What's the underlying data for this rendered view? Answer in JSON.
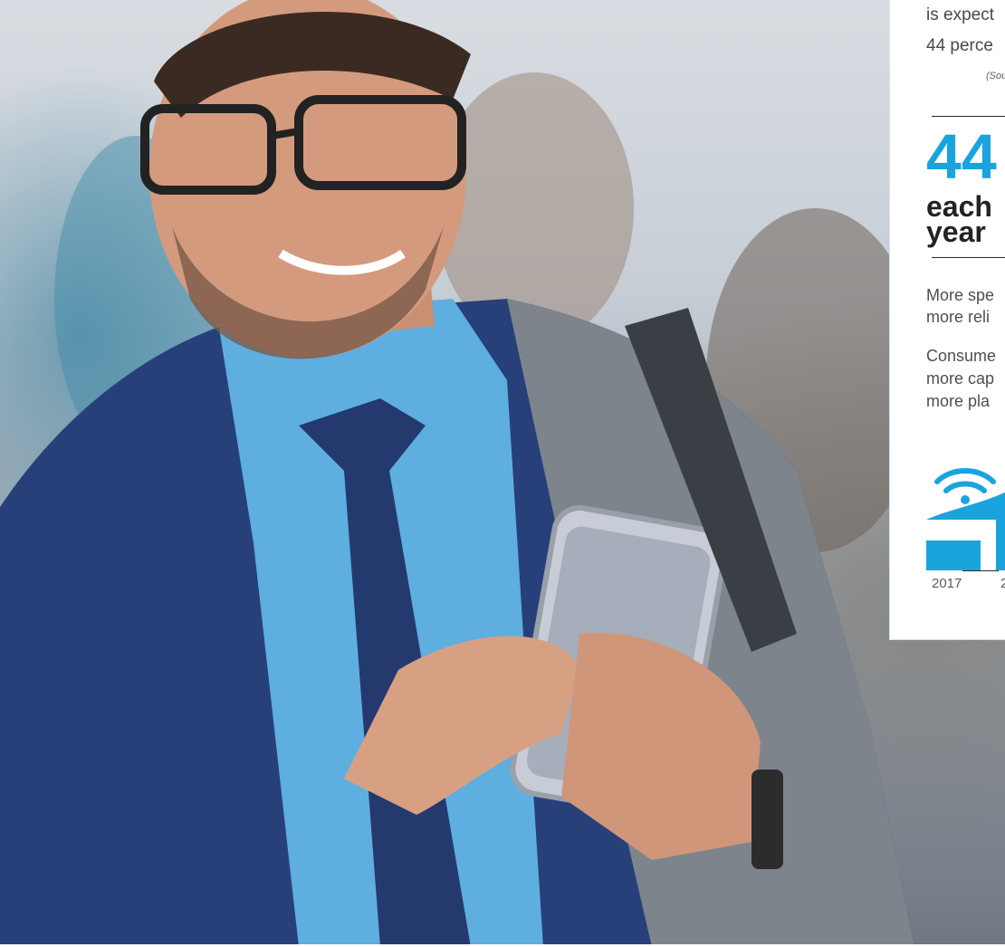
{
  "panel": {
    "intro_lines": [
      "is expect",
      "44 perce"
    ],
    "source_note": "(Sou",
    "big_stat": "44",
    "stat_label_lines": [
      "each",
      "year"
    ],
    "paragraph1_lines": [
      "More spe",
      "more reli"
    ],
    "paragraph2_lines": [
      "Consume",
      "more cap",
      "more pla"
    ],
    "icon": "wifi-signal-icon",
    "accent_color": "#1aa4dd",
    "bar_years": [
      "2017",
      "2"
    ]
  },
  "photo": {
    "subject": "smiling-man-with-smartphone-photo"
  }
}
